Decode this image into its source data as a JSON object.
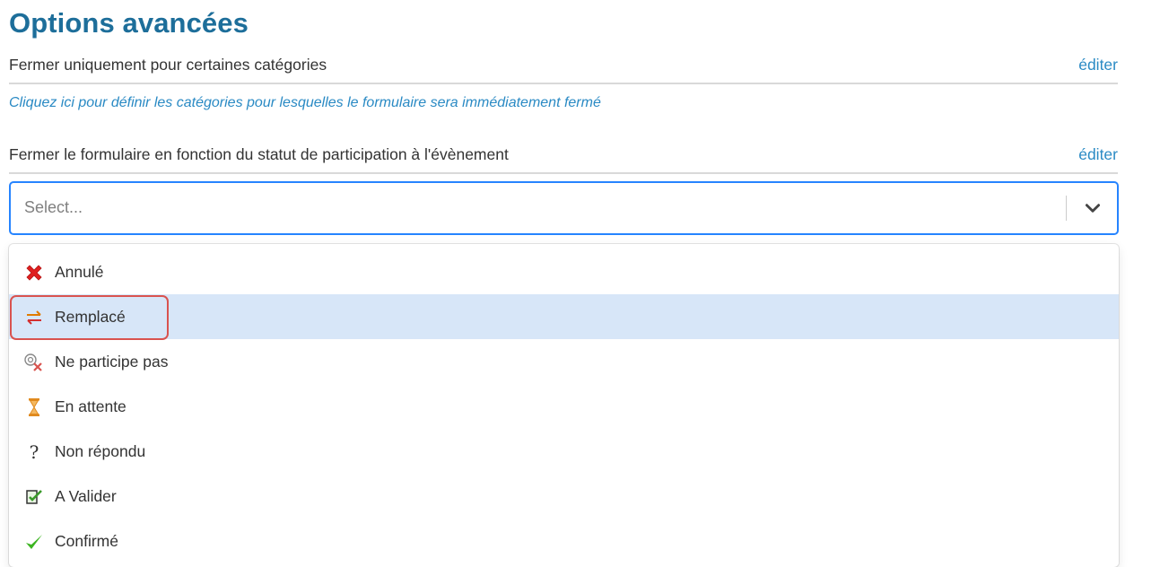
{
  "title": "Options avancées",
  "categories_row": {
    "label": "Fermer uniquement pour certaines catégories",
    "edit": "éditer"
  },
  "categories_hint": "Cliquez ici pour définir les catégories pour lesquelles le formulaire sera immédiatement fermé",
  "status_row": {
    "label": "Fermer le formulaire en fonction du statut de participation à l'évènement",
    "edit": "éditer"
  },
  "select": {
    "placeholder": "Select...",
    "icon": "chevron-down-icon"
  },
  "options": [
    {
      "label": "Annulé",
      "icon": "red-cross-icon"
    },
    {
      "label": "Remplacé",
      "icon": "swap-arrows-icon",
      "focused": true,
      "highlighted": true
    },
    {
      "label": "Ne participe pas",
      "icon": "not-participating-icon"
    },
    {
      "label": "En attente",
      "icon": "hourglass-icon"
    },
    {
      "label": "Non répondu",
      "icon": "question-mark-icon"
    },
    {
      "label": "A Valider",
      "icon": "validate-document-icon"
    },
    {
      "label": "Confirmé",
      "icon": "green-check-icon"
    }
  ],
  "colors": {
    "title": "#1d6e9a",
    "link": "#2a8ac4",
    "focus_border": "#2684ff",
    "option_focus": "#d7e6f8",
    "highlight": "#d9534f"
  }
}
